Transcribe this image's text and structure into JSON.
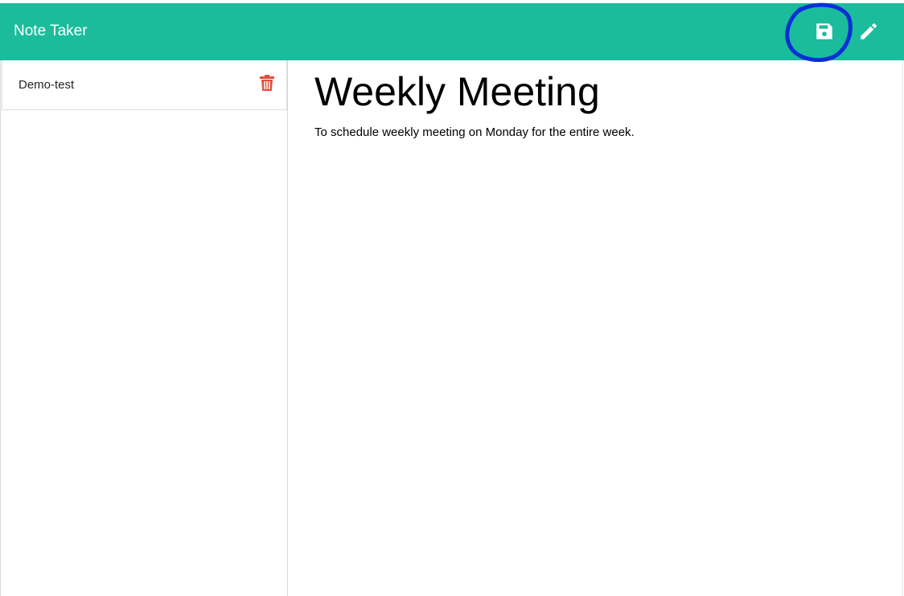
{
  "app": {
    "brand": "Note Taker",
    "colors": {
      "navbar": "#1abc9c",
      "delete": "#e74c3c",
      "annotation": "#0a2fd6"
    }
  },
  "header": {
    "actions": [
      {
        "name": "save",
        "icon": "floppy-disk-icon"
      },
      {
        "name": "new-note",
        "icon": "pencil-icon"
      }
    ]
  },
  "sidebar": {
    "notes": [
      {
        "title": "Demo-test",
        "icon": "trash-icon"
      }
    ]
  },
  "editor": {
    "title": "Weekly Meeting",
    "body": "To schedule weekly meeting on Monday for the entire week."
  }
}
